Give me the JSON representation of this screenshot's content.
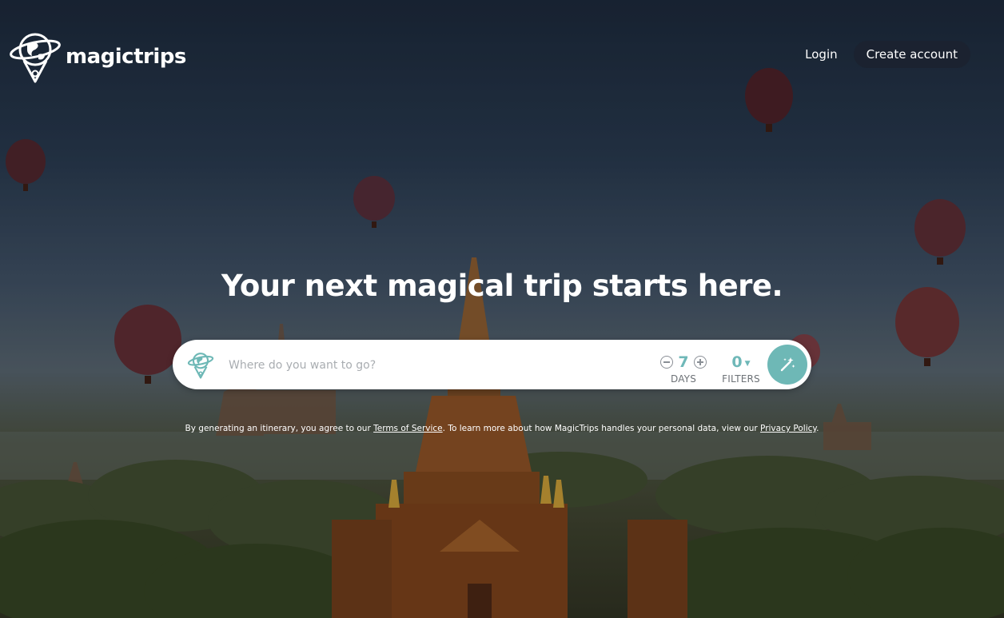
{
  "brand": {
    "name": "magictrips"
  },
  "nav": {
    "login_label": "Login",
    "create_account_label": "Create account"
  },
  "hero": {
    "headline": "Your next magical trip starts here."
  },
  "search": {
    "placeholder": "Where do you want to go?",
    "days_value": "7",
    "days_label": "DAYS",
    "filters_value": "0",
    "filters_label": "FILTERS"
  },
  "legal": {
    "prefix": "By generating an itinerary, you agree to our ",
    "terms_link": "Terms of Service",
    "middle": ". To learn more about how MagicTrips handles your personal data, view our ",
    "privacy_link": "Privacy Policy",
    "suffix": "."
  },
  "colors": {
    "accent": "#6eb8b6",
    "nav_button_bg": "#1b2230"
  },
  "icons": {
    "logo": "globe-pin-icon",
    "minus": "minus-circle-icon",
    "plus": "plus-circle-icon",
    "filters_caret": "caret-down-icon",
    "generate": "magic-wand-icon"
  }
}
